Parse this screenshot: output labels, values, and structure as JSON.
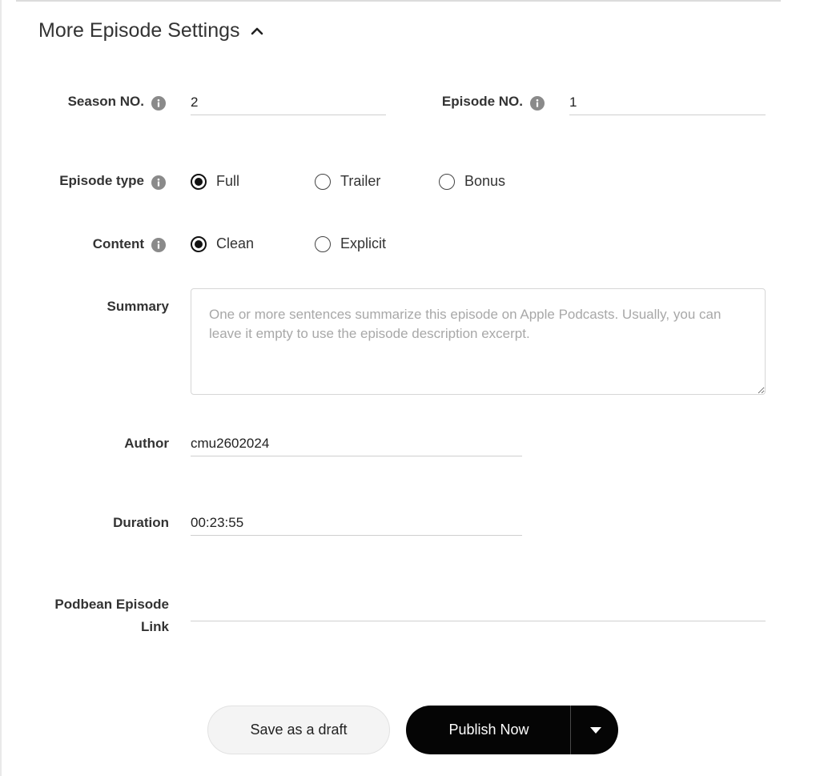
{
  "section": {
    "title": "More Episode Settings"
  },
  "season": {
    "label": "Season NO.",
    "value": "2"
  },
  "episode": {
    "label": "Episode NO.",
    "value": "1"
  },
  "episode_type": {
    "label": "Episode type",
    "options": [
      "Full",
      "Trailer",
      "Bonus"
    ],
    "selected": "Full"
  },
  "content": {
    "label": "Content",
    "options": [
      "Clean",
      "Explicit"
    ],
    "selected": "Clean"
  },
  "summary": {
    "label": "Summary",
    "value": "",
    "placeholder": "One or more sentences summarize this episode on Apple Podcasts. Usually, you can leave it empty to use the episode description excerpt."
  },
  "author": {
    "label": "Author",
    "value": "cmu2602024"
  },
  "duration": {
    "label": "Duration",
    "value": "00:23:55"
  },
  "podbean_link": {
    "label_line1": "Podbean Episode",
    "label_line2": "Link",
    "value": ""
  },
  "actions": {
    "draft_label": "Save as a draft",
    "publish_label": "Publish Now"
  },
  "icons": {
    "info": "info-icon",
    "collapse": "chevron-up-icon",
    "dropdown": "caret-down-icon"
  }
}
